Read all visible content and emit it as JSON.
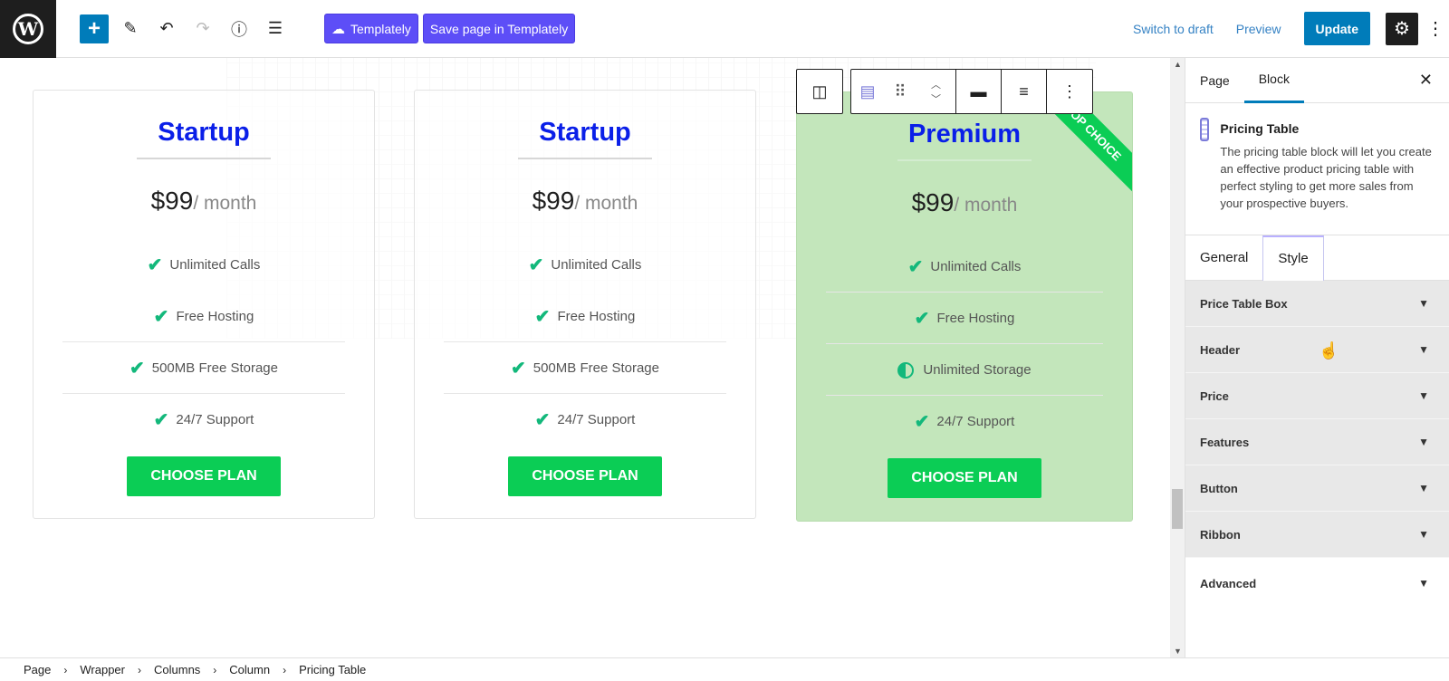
{
  "toolbar": {
    "templately_label": "Templately",
    "save_templately_label": "Save page in Templately",
    "switch_draft": "Switch to draft",
    "preview": "Preview",
    "update": "Update"
  },
  "cards": [
    {
      "title": "Startup",
      "price": "$99",
      "period": "/ month",
      "features": [
        "Unlimited Calls",
        "Free Hosting",
        "500MB Free Storage",
        "24/7 Support"
      ],
      "button": "CHOOSE PLAN"
    },
    {
      "title": "Startup",
      "price": "$99",
      "period": "/ month",
      "features": [
        "Unlimited Calls",
        "Free Hosting",
        "500MB Free Storage",
        "24/7 Support"
      ],
      "button": "CHOOSE PLAN"
    },
    {
      "title": "Premium",
      "price": "$99",
      "period": "/ month",
      "features": [
        "Unlimited Calls",
        "Free Hosting",
        "Unlimited Storage",
        "24/7 Support"
      ],
      "button": "CHOOSE PLAN",
      "ribbon": "TOP CHOICE"
    }
  ],
  "sidebar": {
    "tab_page": "Page",
    "tab_block": "Block",
    "block_name": "Pricing Table",
    "block_desc": "The pricing table block will let you create an effective product pricing table with perfect styling to get more sales from your prospective buyers.",
    "sub_general": "General",
    "sub_style": "Style",
    "panels": [
      "Price Table Box",
      "Header",
      "Price",
      "Features",
      "Button",
      "Ribbon"
    ],
    "advanced": "Advanced"
  },
  "breadcrumb": [
    "Page",
    "Wrapper",
    "Columns",
    "Column",
    "Pricing Table"
  ],
  "colors": {
    "accent": "#007cba",
    "templately": "#5d4ef7",
    "green": "#0bcd55",
    "title_blue": "#0a1fe8"
  }
}
